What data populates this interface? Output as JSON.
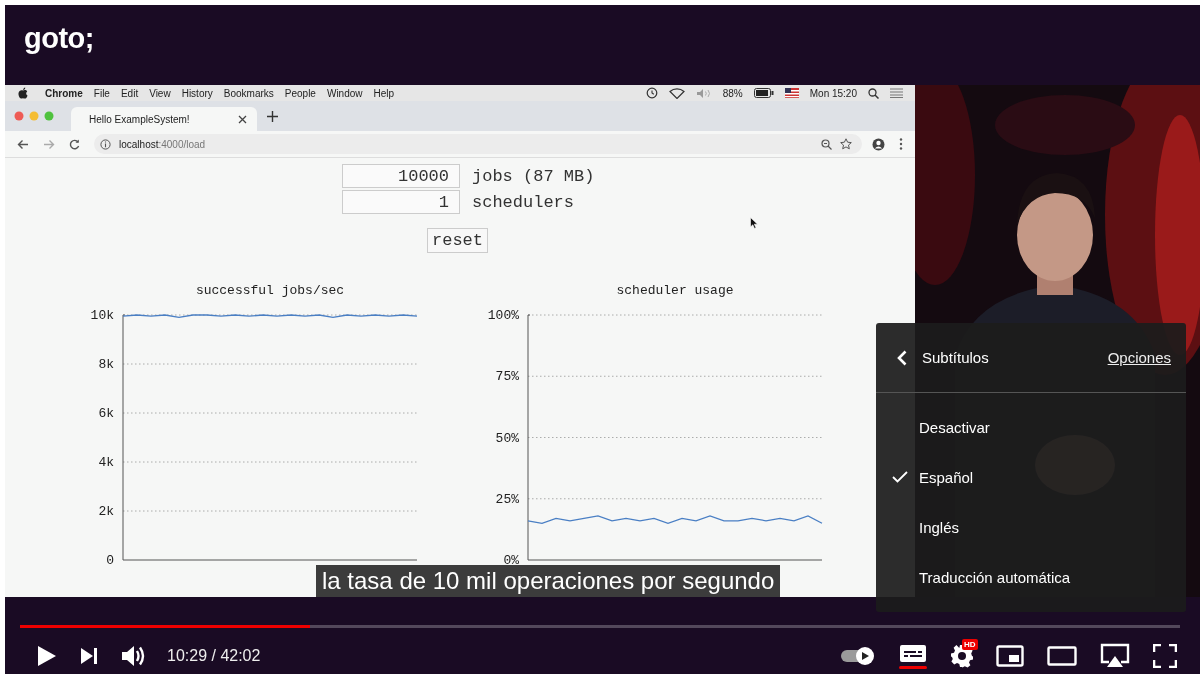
{
  "channel_logo": "goto;",
  "browser": {
    "menu_bar": {
      "app": "Chrome",
      "menus": [
        "File",
        "Edit",
        "View",
        "History",
        "Bookmarks",
        "People",
        "Window",
        "Help"
      ],
      "battery": "88%",
      "clock": "Mon 15:20"
    },
    "tab": {
      "title": "Hello ExampleSystem!"
    },
    "address": {
      "host": "localhost",
      "path": ":4000/load"
    },
    "page": {
      "fields": [
        {
          "value": "10000",
          "label": "jobs (87 MB)"
        },
        {
          "value": "1",
          "label": "schedulers"
        }
      ],
      "reset_button": "reset",
      "charts": [
        {
          "chart_data": {
            "type": "line",
            "title": "successful jobs/sec",
            "grid": true,
            "ylim": [
              0,
              10000
            ],
            "yticks": [
              {
                "value": 0,
                "label": "0"
              },
              {
                "value": 2000,
                "label": "2k"
              },
              {
                "value": 4000,
                "label": "4k"
              },
              {
                "value": 6000,
                "label": "6k"
              },
              {
                "value": 8000,
                "label": "8k"
              },
              {
                "value": 10000,
                "label": "10k"
              }
            ],
            "series": [
              {
                "color": "#4a7fc4",
                "values": [
                  9950,
                  10000,
                  9950,
                  10000,
                  9900,
                  10000,
                  10000,
                  9950,
                  10000,
                  9950,
                  10000,
                  9950,
                  10000,
                  9950,
                  10000,
                  9900,
                  10000,
                  9950,
                  10000,
                  9950,
                  10000,
                  9950
                ]
              }
            ]
          }
        },
        {
          "chart_data": {
            "type": "line",
            "title": "scheduler usage",
            "grid": true,
            "ylim": [
              0,
              100
            ],
            "yticks": [
              {
                "value": 0,
                "label": "0%"
              },
              {
                "value": 25,
                "label": "25%"
              },
              {
                "value": 50,
                "label": "50%"
              },
              {
                "value": 75,
                "label": "75%"
              },
              {
                "value": 100,
                "label": "100%"
              }
            ],
            "series": [
              {
                "color": "#4a7fc4",
                "values": [
                  16,
                  15,
                  17,
                  16,
                  17,
                  18,
                  16,
                  17,
                  16,
                  17,
                  15,
                  17,
                  16,
                  18,
                  16,
                  16,
                  17,
                  16,
                  17,
                  16,
                  18,
                  15
                ]
              }
            ]
          }
        }
      ]
    }
  },
  "caption": "la tasa de 10 mil operaciones por segundo",
  "subtitle_menu": {
    "title": "Subtítulos",
    "options_link": "Opciones",
    "items": [
      {
        "label": "Desactivar",
        "selected": false
      },
      {
        "label": "Español",
        "selected": true
      },
      {
        "label": "Inglés",
        "selected": false
      },
      {
        "label": "Traducción automática",
        "selected": false
      }
    ]
  },
  "player": {
    "progress": {
      "level": 0.25
    },
    "time": "10:29 / 42:02",
    "autoplay": {
      "on": true
    },
    "subtitles": {
      "on": true
    },
    "settings": {
      "badge": "HD"
    }
  }
}
